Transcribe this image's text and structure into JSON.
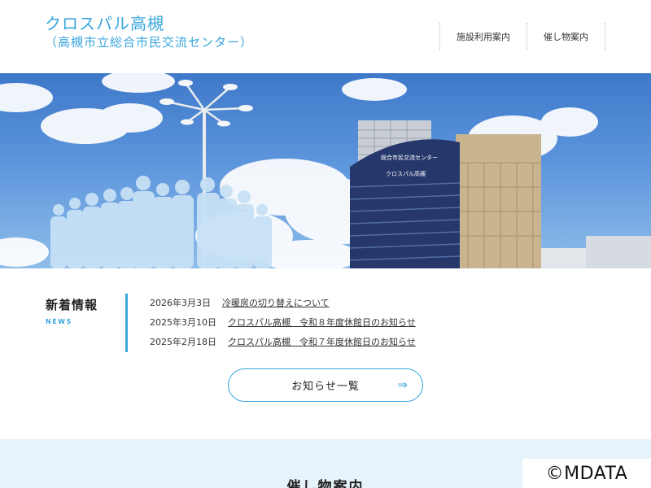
{
  "header": {
    "logo_main": "クロスパル高槻",
    "logo_sub": "（高槻市立総合市民交流センター）",
    "nav": [
      {
        "label": "施設利用案内"
      },
      {
        "label": "催し物案内"
      }
    ]
  },
  "hero": {
    "building_sign_1": "総合市民交流センター",
    "building_sign_2": "クロスパル高槻"
  },
  "news": {
    "title": "新着情報",
    "subtitle": "NEWS",
    "items": [
      {
        "date": "2026年3月3日",
        "text": "冷暖房の切り替えについて"
      },
      {
        "date": "2025年3月10日",
        "text": "クロスパル高槻　令和８年度休館日のお知らせ"
      },
      {
        "date": "2025年2月18日",
        "text": "クロスパル高槻　令和７年度休館日のお知らせ"
      }
    ],
    "more_label": "お知らせ一覧",
    "more_arrow": "⇒"
  },
  "events": {
    "title": "催し物案内"
  },
  "watermark": "©MDATA",
  "colors": {
    "accent": "#3aa6dd",
    "events_bg": "#e6f3fa"
  }
}
